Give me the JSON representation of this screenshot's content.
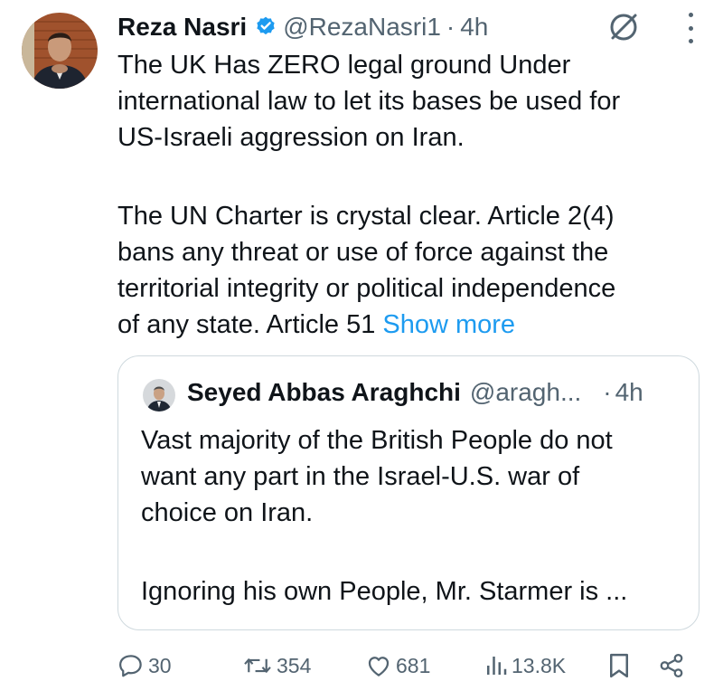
{
  "author": {
    "name": "Reza Nasri",
    "handle": "@RezaNasri1",
    "separator": "·",
    "time": "4h",
    "verified": true,
    "badge_color": "#1d9bf0"
  },
  "tweet": {
    "lines_para1": [
      "The UK Has ZERO legal ground Under",
      "international law to let its bases be used for",
      "US-Israeli aggression on Iran."
    ],
    "lines_para2": [
      "The UN Charter is crystal clear. Article 2(4)",
      "bans any threat or use of force against the",
      "territorial integrity or political independence"
    ],
    "last_line": "of any state. Article 51 ",
    "show_more": "Show more"
  },
  "quote": {
    "name": "Seyed Abbas Araghchi",
    "handle": "@aragh...",
    "separator": "·",
    "time": "4h",
    "lines_para1": [
      "Vast majority of the British People do not",
      "want any part in the Israel-U.S. war of",
      "choice on Iran."
    ],
    "line_para2": "Ignoring his own People, Mr. Starmer is ..."
  },
  "actions": {
    "replies": "30",
    "reposts": "354",
    "likes": "681",
    "views": "13.8K"
  },
  "icons": {
    "grok": "grok-icon",
    "more": "more-dots-icon",
    "reply": "reply-icon",
    "repost": "repost-icon",
    "like": "heart-icon",
    "views": "views-chart-icon",
    "bookmark": "bookmark-icon",
    "share": "share-icon"
  },
  "colors": {
    "text": "#0f1419",
    "secondary": "#536471",
    "link": "#1d9bf0",
    "border": "#cfd9de"
  }
}
